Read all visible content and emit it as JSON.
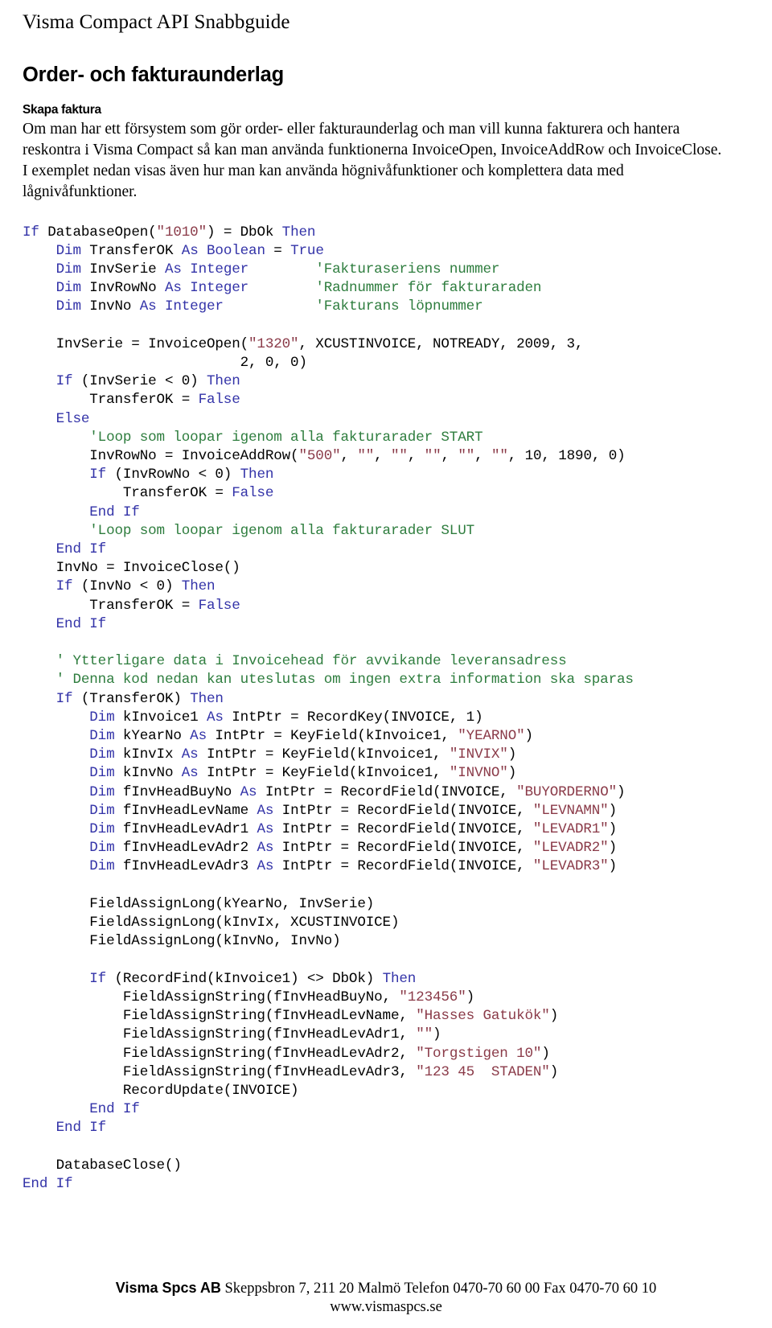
{
  "document": {
    "header": "Visma Compact API Snabbguide",
    "title": "Order- och fakturaunderlag",
    "section_heading": "Skapa faktura",
    "intro_paragraph": "Om man har ett försystem som gör order- eller fakturaunderlag och man vill kunna fakturera och hantera reskontra i Visma Compact så kan man använda funktionerna InvoiceOpen, InvoiceAddRow och InvoiceClose. I exemplet nedan visas även hur man kan använda högnivåfunktioner och komplettera data med lågnivåfunktioner."
  },
  "colors": {
    "keyword": "#3333a8",
    "string": "#8a3a48",
    "comment": "#2e7d3e",
    "plain": "#000000",
    "background": "#ffffff"
  },
  "code": {
    "language": "VB.NET",
    "lines": [
      [
        {
          "t": "If ",
          "c": "kw"
        },
        {
          "t": "DatabaseOpen(",
          "c": "pl"
        },
        {
          "t": "\"1010\"",
          "c": "str"
        },
        {
          "t": ") = DbOk ",
          "c": "pl"
        },
        {
          "t": "Then",
          "c": "kw"
        }
      ],
      [
        {
          "t": "    ",
          "c": "pl"
        },
        {
          "t": "Dim",
          "c": "kw"
        },
        {
          "t": " TransferOK ",
          "c": "pl"
        },
        {
          "t": "As Boolean",
          "c": "kw"
        },
        {
          "t": " = ",
          "c": "pl"
        },
        {
          "t": "True",
          "c": "kw"
        }
      ],
      [
        {
          "t": "    ",
          "c": "pl"
        },
        {
          "t": "Dim",
          "c": "kw"
        },
        {
          "t": " InvSerie ",
          "c": "pl"
        },
        {
          "t": "As Integer",
          "c": "kw"
        },
        {
          "t": "        ",
          "c": "pl"
        },
        {
          "t": "'Fakturaseriens nummer",
          "c": "cmt"
        }
      ],
      [
        {
          "t": "    ",
          "c": "pl"
        },
        {
          "t": "Dim",
          "c": "kw"
        },
        {
          "t": " InvRowNo ",
          "c": "pl"
        },
        {
          "t": "As Integer",
          "c": "kw"
        },
        {
          "t": "        ",
          "c": "pl"
        },
        {
          "t": "'Radnummer för fakturaraden",
          "c": "cmt"
        }
      ],
      [
        {
          "t": "    ",
          "c": "pl"
        },
        {
          "t": "Dim",
          "c": "kw"
        },
        {
          "t": " InvNo ",
          "c": "pl"
        },
        {
          "t": "As Integer",
          "c": "kw"
        },
        {
          "t": "           ",
          "c": "pl"
        },
        {
          "t": "'Fakturans löpnummer",
          "c": "cmt"
        }
      ],
      [
        {
          "t": "",
          "c": "pl"
        }
      ],
      [
        {
          "t": "    InvSerie = InvoiceOpen(",
          "c": "pl"
        },
        {
          "t": "\"1320\"",
          "c": "str"
        },
        {
          "t": ", XCUSTINVOICE, NOTREADY, 2009, 3,",
          "c": "pl"
        }
      ],
      [
        {
          "t": "                          2, 0, 0)",
          "c": "pl"
        }
      ],
      [
        {
          "t": "    ",
          "c": "pl"
        },
        {
          "t": "If",
          "c": "kw"
        },
        {
          "t": " (InvSerie < 0) ",
          "c": "pl"
        },
        {
          "t": "Then",
          "c": "kw"
        }
      ],
      [
        {
          "t": "        TransferOK = ",
          "c": "pl"
        },
        {
          "t": "False",
          "c": "kw"
        }
      ],
      [
        {
          "t": "    ",
          "c": "pl"
        },
        {
          "t": "Else",
          "c": "kw"
        }
      ],
      [
        {
          "t": "        ",
          "c": "pl"
        },
        {
          "t": "'Loop som loopar igenom alla fakturarader START",
          "c": "cmt"
        }
      ],
      [
        {
          "t": "        InvRowNo = InvoiceAddRow(",
          "c": "pl"
        },
        {
          "t": "\"500\"",
          "c": "str"
        },
        {
          "t": ", ",
          "c": "pl"
        },
        {
          "t": "\"\"",
          "c": "str"
        },
        {
          "t": ", ",
          "c": "pl"
        },
        {
          "t": "\"\"",
          "c": "str"
        },
        {
          "t": ", ",
          "c": "pl"
        },
        {
          "t": "\"\"",
          "c": "str"
        },
        {
          "t": ", ",
          "c": "pl"
        },
        {
          "t": "\"\"",
          "c": "str"
        },
        {
          "t": ", ",
          "c": "pl"
        },
        {
          "t": "\"\"",
          "c": "str"
        },
        {
          "t": ", 10, 1890, 0)",
          "c": "pl"
        }
      ],
      [
        {
          "t": "        ",
          "c": "pl"
        },
        {
          "t": "If",
          "c": "kw"
        },
        {
          "t": " (InvRowNo < 0) ",
          "c": "pl"
        },
        {
          "t": "Then",
          "c": "kw"
        }
      ],
      [
        {
          "t": "            TransferOK = ",
          "c": "pl"
        },
        {
          "t": "False",
          "c": "kw"
        }
      ],
      [
        {
          "t": "        ",
          "c": "pl"
        },
        {
          "t": "End If",
          "c": "kw"
        }
      ],
      [
        {
          "t": "        ",
          "c": "pl"
        },
        {
          "t": "'Loop som loopar igenom alla fakturarader SLUT",
          "c": "cmt"
        }
      ],
      [
        {
          "t": "    ",
          "c": "pl"
        },
        {
          "t": "End If",
          "c": "kw"
        }
      ],
      [
        {
          "t": "    InvNo = InvoiceClose()",
          "c": "pl"
        }
      ],
      [
        {
          "t": "    ",
          "c": "pl"
        },
        {
          "t": "If",
          "c": "kw"
        },
        {
          "t": " (InvNo < 0) ",
          "c": "pl"
        },
        {
          "t": "Then",
          "c": "kw"
        }
      ],
      [
        {
          "t": "        TransferOK = ",
          "c": "pl"
        },
        {
          "t": "False",
          "c": "kw"
        }
      ],
      [
        {
          "t": "    ",
          "c": "pl"
        },
        {
          "t": "End If",
          "c": "kw"
        }
      ],
      [
        {
          "t": "",
          "c": "pl"
        }
      ],
      [
        {
          "t": "    ",
          "c": "pl"
        },
        {
          "t": "' Ytterligare data i Invoicehead för avvikande leveransadress",
          "c": "cmt"
        }
      ],
      [
        {
          "t": "    ",
          "c": "pl"
        },
        {
          "t": "' Denna kod nedan kan uteslutas om ingen extra information ska sparas",
          "c": "cmt"
        }
      ],
      [
        {
          "t": "    ",
          "c": "pl"
        },
        {
          "t": "If",
          "c": "kw"
        },
        {
          "t": " (TransferOK) ",
          "c": "pl"
        },
        {
          "t": "Then",
          "c": "kw"
        }
      ],
      [
        {
          "t": "        ",
          "c": "pl"
        },
        {
          "t": "Dim",
          "c": "kw"
        },
        {
          "t": " kInvoice1 ",
          "c": "pl"
        },
        {
          "t": "As",
          "c": "kw"
        },
        {
          "t": " IntPtr = RecordKey(INVOICE, 1)",
          "c": "pl"
        }
      ],
      [
        {
          "t": "        ",
          "c": "pl"
        },
        {
          "t": "Dim",
          "c": "kw"
        },
        {
          "t": " kYearNo ",
          "c": "pl"
        },
        {
          "t": "As",
          "c": "kw"
        },
        {
          "t": " IntPtr = KeyField(kInvoice1, ",
          "c": "pl"
        },
        {
          "t": "\"YEARNO\"",
          "c": "str"
        },
        {
          "t": ")",
          "c": "pl"
        }
      ],
      [
        {
          "t": "        ",
          "c": "pl"
        },
        {
          "t": "Dim",
          "c": "kw"
        },
        {
          "t": " kInvIx ",
          "c": "pl"
        },
        {
          "t": "As",
          "c": "kw"
        },
        {
          "t": " IntPtr = KeyField(kInvoice1, ",
          "c": "pl"
        },
        {
          "t": "\"INVIX\"",
          "c": "str"
        },
        {
          "t": ")",
          "c": "pl"
        }
      ],
      [
        {
          "t": "        ",
          "c": "pl"
        },
        {
          "t": "Dim",
          "c": "kw"
        },
        {
          "t": " kInvNo ",
          "c": "pl"
        },
        {
          "t": "As",
          "c": "kw"
        },
        {
          "t": " IntPtr = KeyField(kInvoice1, ",
          "c": "pl"
        },
        {
          "t": "\"INVNO\"",
          "c": "str"
        },
        {
          "t": ")",
          "c": "pl"
        }
      ],
      [
        {
          "t": "        ",
          "c": "pl"
        },
        {
          "t": "Dim",
          "c": "kw"
        },
        {
          "t": " fInvHeadBuyNo ",
          "c": "pl"
        },
        {
          "t": "As",
          "c": "kw"
        },
        {
          "t": " IntPtr = RecordField(INVOICE, ",
          "c": "pl"
        },
        {
          "t": "\"BUYORDERNO\"",
          "c": "str"
        },
        {
          "t": ")",
          "c": "pl"
        }
      ],
      [
        {
          "t": "        ",
          "c": "pl"
        },
        {
          "t": "Dim",
          "c": "kw"
        },
        {
          "t": " fInvHeadLevName ",
          "c": "pl"
        },
        {
          "t": "As",
          "c": "kw"
        },
        {
          "t": " IntPtr = RecordField(INVOICE, ",
          "c": "pl"
        },
        {
          "t": "\"LEVNAMN\"",
          "c": "str"
        },
        {
          "t": ")",
          "c": "pl"
        }
      ],
      [
        {
          "t": "        ",
          "c": "pl"
        },
        {
          "t": "Dim",
          "c": "kw"
        },
        {
          "t": " fInvHeadLevAdr1 ",
          "c": "pl"
        },
        {
          "t": "As",
          "c": "kw"
        },
        {
          "t": " IntPtr = RecordField(INVOICE, ",
          "c": "pl"
        },
        {
          "t": "\"LEVADR1\"",
          "c": "str"
        },
        {
          "t": ")",
          "c": "pl"
        }
      ],
      [
        {
          "t": "        ",
          "c": "pl"
        },
        {
          "t": "Dim",
          "c": "kw"
        },
        {
          "t": " fInvHeadLevAdr2 ",
          "c": "pl"
        },
        {
          "t": "As",
          "c": "kw"
        },
        {
          "t": " IntPtr = RecordField(INVOICE, ",
          "c": "pl"
        },
        {
          "t": "\"LEVADR2\"",
          "c": "str"
        },
        {
          "t": ")",
          "c": "pl"
        }
      ],
      [
        {
          "t": "        ",
          "c": "pl"
        },
        {
          "t": "Dim",
          "c": "kw"
        },
        {
          "t": " fInvHeadLevAdr3 ",
          "c": "pl"
        },
        {
          "t": "As",
          "c": "kw"
        },
        {
          "t": " IntPtr = RecordField(INVOICE, ",
          "c": "pl"
        },
        {
          "t": "\"LEVADR3\"",
          "c": "str"
        },
        {
          "t": ")",
          "c": "pl"
        }
      ],
      [
        {
          "t": "",
          "c": "pl"
        }
      ],
      [
        {
          "t": "        FieldAssignLong(kYearNo, InvSerie)",
          "c": "pl"
        }
      ],
      [
        {
          "t": "        FieldAssignLong(kInvIx, XCUSTINVOICE)",
          "c": "pl"
        }
      ],
      [
        {
          "t": "        FieldAssignLong(kInvNo, InvNo)",
          "c": "pl"
        }
      ],
      [
        {
          "t": "",
          "c": "pl"
        }
      ],
      [
        {
          "t": "        ",
          "c": "pl"
        },
        {
          "t": "If",
          "c": "kw"
        },
        {
          "t": " (RecordFind(kInvoice1) <> DbOk) ",
          "c": "pl"
        },
        {
          "t": "Then",
          "c": "kw"
        }
      ],
      [
        {
          "t": "            FieldAssignString(fInvHeadBuyNo, ",
          "c": "pl"
        },
        {
          "t": "\"123456\"",
          "c": "str"
        },
        {
          "t": ")",
          "c": "pl"
        }
      ],
      [
        {
          "t": "            FieldAssignString(fInvHeadLevName, ",
          "c": "pl"
        },
        {
          "t": "\"Hasses Gatukök\"",
          "c": "str"
        },
        {
          "t": ")",
          "c": "pl"
        }
      ],
      [
        {
          "t": "            FieldAssignString(fInvHeadLevAdr1, ",
          "c": "pl"
        },
        {
          "t": "\"\"",
          "c": "str"
        },
        {
          "t": ")",
          "c": "pl"
        }
      ],
      [
        {
          "t": "            FieldAssignString(fInvHeadLevAdr2, ",
          "c": "pl"
        },
        {
          "t": "\"Torgstigen 10\"",
          "c": "str"
        },
        {
          "t": ")",
          "c": "pl"
        }
      ],
      [
        {
          "t": "            FieldAssignString(fInvHeadLevAdr3, ",
          "c": "pl"
        },
        {
          "t": "\"123 45  STADEN\"",
          "c": "str"
        },
        {
          "t": ")",
          "c": "pl"
        }
      ],
      [
        {
          "t": "            RecordUpdate(INVOICE)",
          "c": "pl"
        }
      ],
      [
        {
          "t": "        ",
          "c": "pl"
        },
        {
          "t": "End If",
          "c": "kw"
        }
      ],
      [
        {
          "t": "    ",
          "c": "pl"
        },
        {
          "t": "End If",
          "c": "kw"
        }
      ],
      [
        {
          "t": "",
          "c": "pl"
        }
      ],
      [
        {
          "t": "    DatabaseClose()",
          "c": "pl"
        }
      ],
      [
        {
          "t": "End If",
          "c": "kw"
        }
      ]
    ]
  },
  "footer": {
    "company": "Visma Spcs AB",
    "address_line": " Skeppsbron 7, 211 20 Malmö Telefon 0470-70 60 00 Fax 0470-70 60 10",
    "website": "www.vismaspcs.se"
  }
}
